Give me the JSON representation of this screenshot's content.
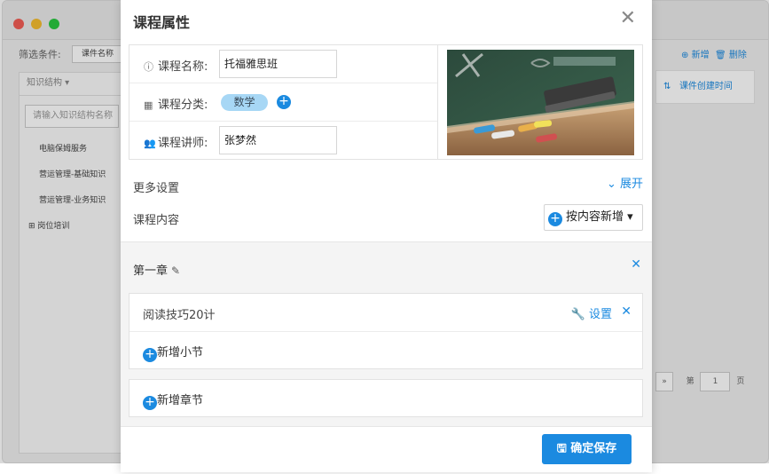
{
  "background": {
    "filter_label": "筛选条件:",
    "filter_chip": "课件名称",
    "tree_header": "知识结构",
    "tree_search_placeholder": "请输入知识结构名称",
    "tree_items": [
      "电脑保姆服务",
      "营运管理-基础知识",
      "营运管理-业务知识",
      "岗位培训"
    ],
    "action_add": "新增",
    "action_delete": "删除",
    "sort_label": "课件创建时间",
    "pager_prefix": "第",
    "pager_page": "1",
    "pager_suffix": "页",
    "pager_next": "»"
  },
  "dialog": {
    "title": "课程属性",
    "close_label": "✕",
    "fields": {
      "name_label": "课程名称:",
      "name_value": "托福雅思班",
      "category_label": "课程分类:",
      "category_tag": "数学",
      "teacher_label": "课程讲师:",
      "teacher_value": "张梦然"
    },
    "more_settings": "更多设置",
    "expand_label": "展开",
    "course_content": "课程内容",
    "add_by_content": "按内容新增",
    "chapter": {
      "title": "第一章",
      "section_name": "阅读技巧20计",
      "settings_label": "设置",
      "add_subsection": "新增小节",
      "add_chapter": "新增章节"
    },
    "save_label": "确定保存"
  },
  "colors": {
    "accent": "#1b8ae0",
    "tag": "#a7d7f5"
  }
}
